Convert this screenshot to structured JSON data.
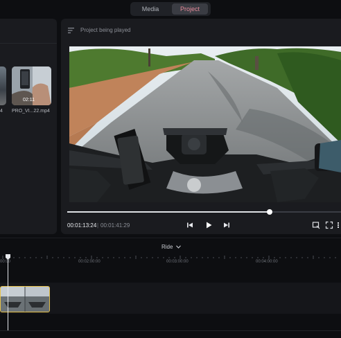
{
  "top_tabs": {
    "media": "Media",
    "project": "Project"
  },
  "media_panel": {
    "items": [
      {
        "label": "4"
      },
      {
        "label": "PRO_VI...22.mp4",
        "duration": "02:11"
      }
    ]
  },
  "player": {
    "title": "Project being played",
    "current_time": "00:01:13:24",
    "separator": "|",
    "total_time": "00:01:41:29",
    "progress": 0.74
  },
  "timeline": {
    "name": "Ride",
    "ticks": [
      "00:00",
      "00:02:00:00",
      "00:03:00:00",
      "00:04:00:00"
    ]
  },
  "colors": {
    "accent": "#e58a9a",
    "clip_border": "#e7c24a"
  }
}
